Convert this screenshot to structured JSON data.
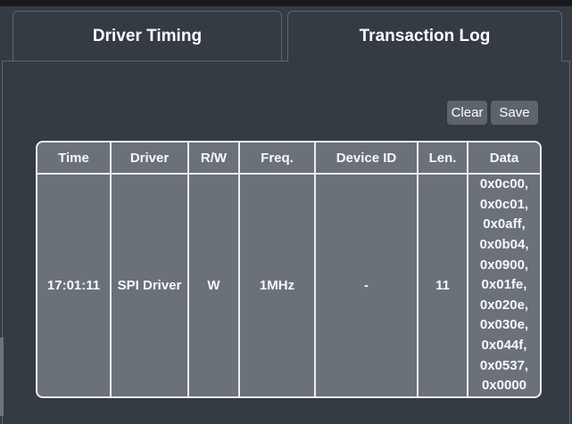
{
  "tabs": [
    {
      "label": "Driver Timing",
      "active": false
    },
    {
      "label": "Transaction Log",
      "active": true
    }
  ],
  "toolbar": {
    "clear_label": "Clear",
    "save_label": "Save"
  },
  "table": {
    "columns": [
      "Time",
      "Driver",
      "R/W",
      "Freq.",
      "Device ID",
      "Len.",
      "Data"
    ],
    "rows": [
      {
        "time": "17:01:11",
        "driver": "SPI Driver",
        "rw": "W",
        "freq": "1MHz",
        "device_id": "-",
        "len": "11",
        "data": [
          "0x0c00",
          "0x0c01",
          "0x0aff",
          "0x0b04",
          "0x0900",
          "0x01fe",
          "0x020e",
          "0x030e",
          "0x044f",
          "0x0537",
          "0x0000"
        ]
      }
    ]
  },
  "colors": {
    "background": "#343b43",
    "topbar": "#17191d",
    "panel_border": "#5f666e",
    "cell_gray": "#6b7178",
    "button_gray": "#5d646c",
    "grid_lines": "#eceded",
    "text": "#f7f8f9"
  }
}
